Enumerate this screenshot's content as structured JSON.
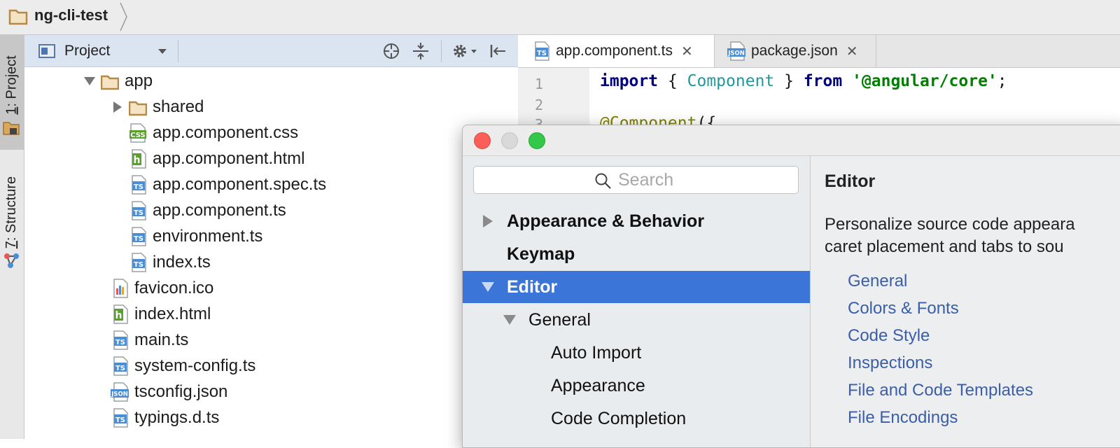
{
  "breadcrumb": {
    "project": "ng-cli-test"
  },
  "tool_strip": {
    "project_tab": {
      "num": "1",
      "label": ": Project"
    },
    "structure_tab": {
      "num": "7",
      "label": ": Structure"
    }
  },
  "project_panel": {
    "view_selector": "Project",
    "tree": [
      {
        "label": "app",
        "icon": "folder-icon",
        "expanded": true
      },
      {
        "label": "shared",
        "icon": "folder-icon",
        "expanded": false
      },
      {
        "label": "app.component.css",
        "icon": "css-file-icon"
      },
      {
        "label": "app.component.html",
        "icon": "html-file-icon"
      },
      {
        "label": "app.component.spec.ts",
        "icon": "ts-file-icon"
      },
      {
        "label": "app.component.ts",
        "icon": "ts-file-icon"
      },
      {
        "label": "environment.ts",
        "icon": "ts-file-icon"
      },
      {
        "label": "index.ts",
        "icon": "ts-file-icon"
      },
      {
        "label": "favicon.ico",
        "icon": "image-file-icon"
      },
      {
        "label": "index.html",
        "icon": "html-file-icon"
      },
      {
        "label": "main.ts",
        "icon": "ts-file-icon"
      },
      {
        "label": "system-config.ts",
        "icon": "ts-file-icon"
      },
      {
        "label": "tsconfig.json",
        "icon": "json-file-icon"
      },
      {
        "label": "typings.d.ts",
        "icon": "ts-file-icon"
      }
    ],
    "icon_badges": {
      "css": "CSS",
      "html": "h",
      "ts": "TS",
      "json": "JSON"
    }
  },
  "editor": {
    "tabs": [
      {
        "label": "app.component.ts",
        "active": true,
        "close": "✕"
      },
      {
        "label": "package.json",
        "active": false,
        "close": "✕"
      }
    ],
    "line_numbers": [
      "1",
      "2",
      "3"
    ],
    "code": {
      "line1": {
        "kw_import": "import",
        "brace_open": " { ",
        "cls": "Component",
        "brace_close": " } ",
        "kw_from": "from",
        "space": " ",
        "str": "'@angular/core'",
        "semi": ";"
      },
      "line3": {
        "ann": "@Component",
        "rest": "({"
      }
    }
  },
  "settings_dialog": {
    "search_placeholder": "Search",
    "nav": [
      {
        "label": "Appearance & Behavior",
        "level": 0,
        "arrow": "right",
        "bold": true
      },
      {
        "label": "Keymap",
        "level": 0,
        "arrow": "none",
        "bold": true
      },
      {
        "label": "Editor",
        "level": 0,
        "arrow": "down",
        "bold": true,
        "selected": true
      },
      {
        "label": "General",
        "level": 1,
        "arrow": "down"
      },
      {
        "label": "Auto Import",
        "level": 2
      },
      {
        "label": "Appearance",
        "level": 2
      },
      {
        "label": "Code Completion",
        "level": 2
      }
    ],
    "content": {
      "title": "Editor",
      "description_line1": "Personalize source code appeara",
      "description_line2": "caret placement and tabs to sou",
      "links": [
        "General",
        "Colors & Fonts",
        "Code Style",
        "Inspections",
        "File and Code Templates",
        "File Encodings"
      ]
    }
  },
  "colors": {
    "selection": "#3a75d7",
    "link": "#3c5ea8",
    "folder": "#b58a47",
    "ts_icon": "#4a8fd6",
    "html_icon": "#5aa02c"
  }
}
